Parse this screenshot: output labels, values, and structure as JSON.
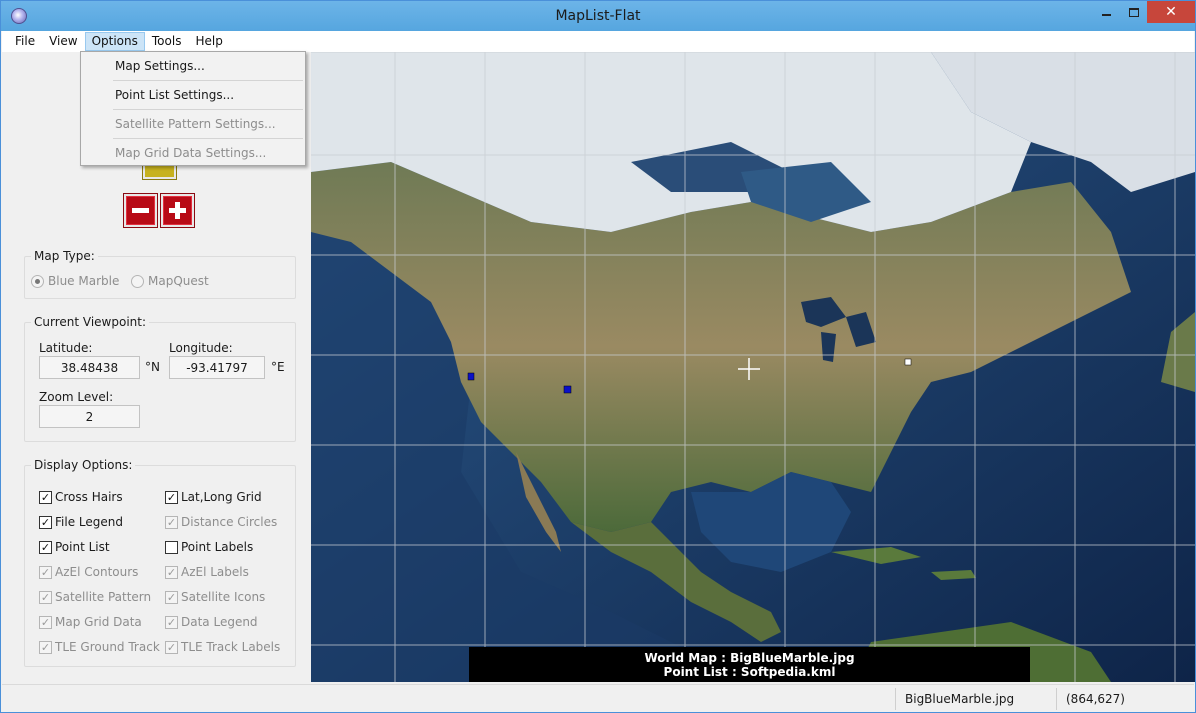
{
  "window": {
    "title": "MapList-Flat",
    "close_glyph": "✕"
  },
  "menubar": {
    "items": [
      "File",
      "View",
      "Options",
      "Tools",
      "Help"
    ]
  },
  "options_menu": {
    "items": [
      {
        "label": "Map Settings...",
        "enabled": true
      },
      {
        "label": "Point List Settings...",
        "enabled": true
      },
      {
        "label": "Satellite Pattern Settings...",
        "enabled": false
      },
      {
        "label": "Map Grid Data Settings...",
        "enabled": false
      }
    ]
  },
  "map_type": {
    "title": "Map Type:",
    "options": [
      {
        "label": "Blue Marble",
        "selected": true
      },
      {
        "label": "MapQuest",
        "selected": false
      }
    ]
  },
  "viewpoint": {
    "title": "Current Viewpoint:",
    "latitude_label": "Latitude:",
    "latitude_value": "38.48438",
    "latitude_unit": "°N",
    "longitude_label": "Longitude:",
    "longitude_value": "-93.41797",
    "longitude_unit": "°E",
    "zoom_label": "Zoom Level:",
    "zoom_value": "2"
  },
  "display_options": {
    "title": "Display Options:",
    "items": [
      {
        "label": "Cross Hairs",
        "checked": true,
        "enabled": true
      },
      {
        "label": "Lat,Long Grid",
        "checked": true,
        "enabled": true
      },
      {
        "label": "File Legend",
        "checked": true,
        "enabled": true
      },
      {
        "label": "Distance Circles",
        "checked": true,
        "enabled": false
      },
      {
        "label": "Point List",
        "checked": true,
        "enabled": true
      },
      {
        "label": "Point Labels",
        "checked": false,
        "enabled": true
      },
      {
        "label": "AzEl Contours",
        "checked": true,
        "enabled": false
      },
      {
        "label": "AzEl Labels",
        "checked": true,
        "enabled": false
      },
      {
        "label": "Satellite Pattern",
        "checked": true,
        "enabled": false
      },
      {
        "label": "Satellite Icons",
        "checked": true,
        "enabled": false
      },
      {
        "label": "Map Grid Data",
        "checked": true,
        "enabled": false
      },
      {
        "label": "Data Legend",
        "checked": true,
        "enabled": false
      },
      {
        "label": "TLE Ground Track",
        "checked": true,
        "enabled": false
      },
      {
        "label": "TLE Track Labels",
        "checked": true,
        "enabled": false
      }
    ]
  },
  "map": {
    "legend_line1": "World Map : BigBlueMarble.jpg",
    "legend_line2": "Point List : Softpedia.kml"
  },
  "statusbar": {
    "file": "BigBlueMarble.jpg",
    "coords": "(864,627)"
  },
  "colors": {
    "titlebar": "#5dade2",
    "zoom_button": "#b80a16",
    "ocean": "#1d3f6e",
    "land": "#8a7a55"
  },
  "icons": [
    "app-globe-icon",
    "minimize-icon",
    "maximize-icon",
    "close-icon",
    "zoom-in-icon",
    "zoom-out-icon",
    "pan-icon",
    "crosshair-icon",
    "check-icon"
  ]
}
